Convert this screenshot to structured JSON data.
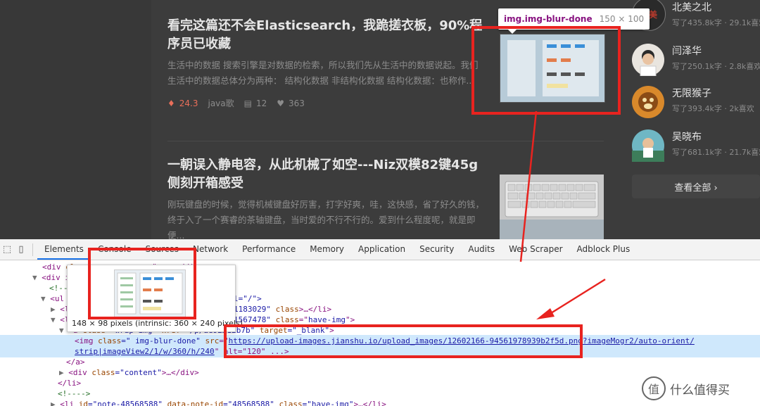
{
  "articles": [
    {
      "title": "看完这篇还不会Elasticsearch，我跪搓衣板，90%程序员已收藏",
      "abstract": "生活中的数据 搜索引擎是对数据的检索，所以我们先从生活中的数据说起。我们生活中的数据总体分为两种： 结构化数据 非结构化数据 结构化数据：也称作...",
      "diamond": "24.3",
      "author": "java歌",
      "comments": "12",
      "likes": "363"
    },
    {
      "title": "一朝误入静电容，从此机械了如空---Niz双模82键45g侧刻开箱感受",
      "abstract": "刚玩键盘的时候，觉得机械键盘好厉害，打字好爽，哇，这快感，省了好久的钱，终于入了一个赛睿的茶轴键盘，当时爱的不行不行的。爱到什么程度呢，就是即便..."
    }
  ],
  "authors": [
    {
      "name": "北美之北",
      "stats": "写了435.8k字 · 29.1k喜欢",
      "avatar_text": "北美"
    },
    {
      "name": "闫泽华",
      "stats": "写了250.1k字 · 2.8k喜欢"
    },
    {
      "name": "无限猴子",
      "stats": "写了393.4k字 · 2k喜欢"
    },
    {
      "name": "吴晓布",
      "stats": "写了681.1k字 · 21.7k喜欢"
    }
  ],
  "view_all": "查看全部 ›",
  "tooltip": {
    "selector": "img.img-blur-done",
    "size": "150 × 100"
  },
  "devtools": {
    "tabs": [
      "Elements",
      "Console",
      "Sources",
      "Network",
      "Performance",
      "Memory",
      "Application",
      "Security",
      "Audits",
      "Web Scraper",
      "Adblock Plus"
    ],
    "active_tab": "Elements"
  },
  "code": {
    "l1_tag": "<div",
    "l1_attr": " cl",
    "l1_tail": "...\">...</div>",
    "l2": "<div i",
    "l3": "<!--",
    "l4_tag": "<ul",
    "l4_tail": "l=\"/\">",
    "l5_tag": "<li",
    "l5_tail_val": "1183029\"",
    "l5_tail_attr": " class",
    "l5_tail_end": ">…</li>",
    "l6_tag": "<li",
    "l6_val": "1567478\"",
    "l6_attr": " class",
    "l6_eq": "=\"",
    "l6_cls": "have-img",
    "l6_end": "\">",
    "l7_tag": "<a",
    "l7_attr": " class",
    "l7_val": "=\"wrap-img\"",
    "l7_href": " href",
    "l7_hval": "=\"/p/ae92…12b7b\"",
    "l7_target": " target",
    "l7_tval": "=\"_blank\"",
    "l7_end": ">",
    "img_tag": "<img",
    "img_class": " class",
    "img_class_val": "=\"  img-blur-done\"",
    "img_src": " src",
    "img_eq": "=\"",
    "img_url": "https://upload-images.jianshu.io/upload_images/12602166-94561978939b2f5d.png?imageMogr2/auto-orient/",
    "img_url2": "strip|imageView2/1/w/360/h/240",
    "img_rest": "\" alt=\"120\" ...>",
    "a_close": "</a>",
    "div_tag": "<div",
    "div_attr": " class",
    "div_val": "=\"content\"",
    "div_end": ">…</div>",
    "li_close": "</li>",
    "cmt": "<!---->",
    "last_tag": "<li",
    "last_id": " id",
    "last_idv": "=\"note-48568588\"",
    "last_did": " data-note-id",
    "last_didv": "=\"48568588\"",
    "last_cls": " class",
    "last_clsv": "=\"have-img\"",
    "last_end": ">…</li>"
  },
  "image_tip": {
    "caption": "148 × 98 pixels (intrinsic: 360 × 240 pixels)"
  },
  "watermark": {
    "badge": "值",
    "text": "什么值得买"
  },
  "colors": {
    "red_box": "#e8231f",
    "tooltip_selector": "#881280",
    "highlight": "#cfe8fc"
  }
}
